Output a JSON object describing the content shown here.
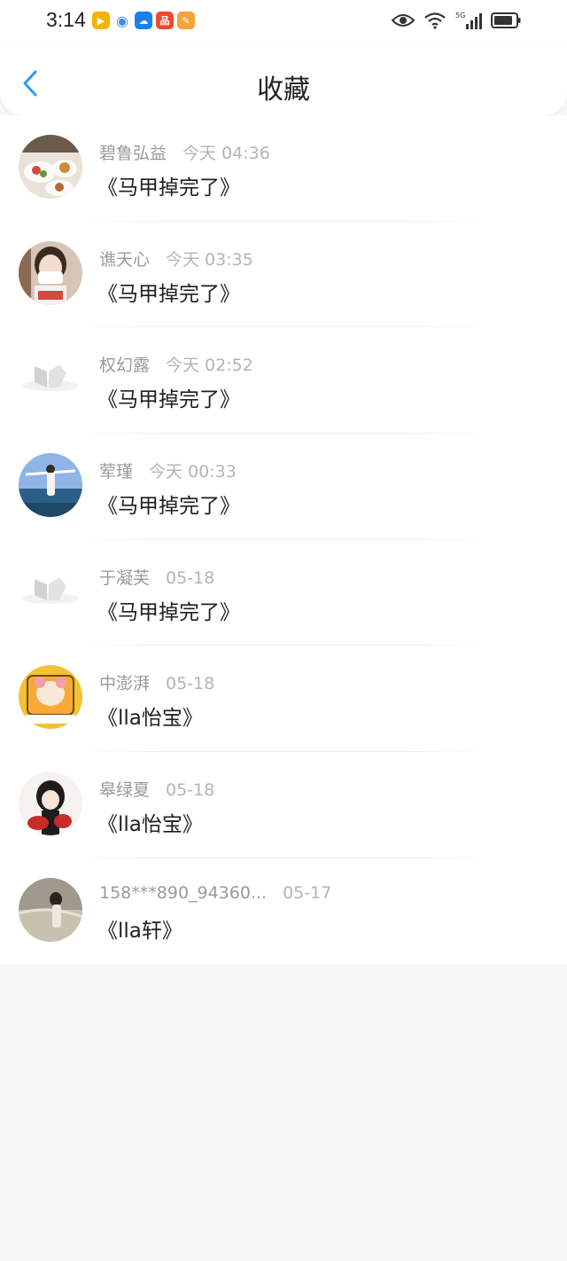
{
  "status_bar": {
    "time": "3:14",
    "app_icons": [
      {
        "name": "video-app-icon",
        "color": "#f5b300",
        "glyph": "▶"
      },
      {
        "name": "browser-app-icon",
        "color": "#3b8de8",
        "glyph": "◉"
      },
      {
        "name": "weather-app-icon",
        "color": "#1a7ff0",
        "glyph": "☁"
      },
      {
        "name": "xiaohongshu-app-icon",
        "color": "#f04a2c",
        "glyph": "品"
      },
      {
        "name": "folder-app-icon",
        "color": "#f2a33a",
        "glyph": "✎"
      }
    ]
  },
  "header": {
    "title": "收藏",
    "accent": "#2e9bf0"
  },
  "items": [
    {
      "name": "碧鲁弘益",
      "time": "今天 04:36",
      "title": "《马甲掉完了》",
      "avatar": "food"
    },
    {
      "name": "谯天心",
      "time": "今天 03:35",
      "title": "《马甲掉完了》",
      "avatar": "girl-mask"
    },
    {
      "name": "权幻露",
      "time": "今天 02:52",
      "title": "《马甲掉完了》",
      "avatar": "placeholder"
    },
    {
      "name": "荤瑾",
      "time": "今天 00:33",
      "title": "《马甲掉完了》",
      "avatar": "sea"
    },
    {
      "name": "于凝芙",
      "time": "05-18",
      "title": "《马甲掉完了》",
      "avatar": "placeholder"
    },
    {
      "name": "中澎湃",
      "time": "05-18",
      "title": "《lla怡宝》",
      "avatar": "cartoon"
    },
    {
      "name": "皋绿夏",
      "time": "05-18",
      "title": "《lla怡宝》",
      "avatar": "anime"
    },
    {
      "name": "158***890_94360...",
      "time": "05-17",
      "title": "《lla轩》",
      "avatar": "beach"
    }
  ]
}
